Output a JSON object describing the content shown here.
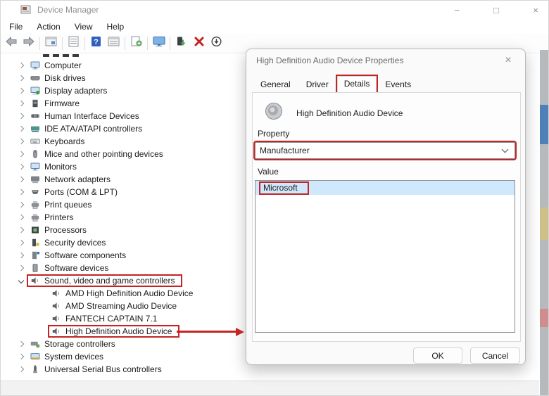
{
  "window": {
    "title": "Device Manager",
    "controls": {
      "minimize": "−",
      "maximize": "□",
      "close": "×"
    }
  },
  "menu": [
    "File",
    "Action",
    "View",
    "Help"
  ],
  "toolbar": [
    {
      "name": "nav-back-button",
      "icon": "back-icon"
    },
    {
      "name": "nav-forward-button",
      "icon": "forward-icon"
    },
    {
      "sep": true
    },
    {
      "name": "show-console-tree-button",
      "icon": "console-window-icon"
    },
    {
      "sep": true
    },
    {
      "name": "properties-button",
      "icon": "properties-icon"
    },
    {
      "sep": true
    },
    {
      "name": "help-button",
      "icon": "help-icon"
    },
    {
      "name": "items-list-button",
      "icon": "list-window-icon"
    },
    {
      "sep": true
    },
    {
      "name": "scan-hardware-button",
      "icon": "scan-hardware-icon"
    },
    {
      "sep": true
    },
    {
      "name": "computer-button",
      "icon": "monitor-icon"
    },
    {
      "sep": true
    },
    {
      "name": "update-driver-button",
      "icon": "update-driver-icon"
    },
    {
      "name": "uninstall-device-button",
      "icon": "uninstall-icon"
    },
    {
      "name": "disable-device-button",
      "icon": "disable-icon"
    }
  ],
  "tree": [
    {
      "label": "Computer",
      "level": 0,
      "chevron": "right",
      "icon": "monitor"
    },
    {
      "label": "Disk drives",
      "level": 0,
      "chevron": "right",
      "icon": "disk"
    },
    {
      "label": "Display adapters",
      "level": 0,
      "chevron": "right",
      "icon": "display"
    },
    {
      "label": "Firmware",
      "level": 0,
      "chevron": "right",
      "icon": "firmware"
    },
    {
      "label": "Human Interface Devices",
      "level": 0,
      "chevron": "right",
      "icon": "hid"
    },
    {
      "label": "IDE ATA/ATAPI controllers",
      "level": 0,
      "chevron": "right",
      "icon": "ide"
    },
    {
      "label": "Keyboards",
      "level": 0,
      "chevron": "right",
      "icon": "keyboard"
    },
    {
      "label": "Mice and other pointing devices",
      "level": 0,
      "chevron": "right",
      "icon": "mouse"
    },
    {
      "label": "Monitors",
      "level": 0,
      "chevron": "right",
      "icon": "monitor"
    },
    {
      "label": "Network adapters",
      "level": 0,
      "chevron": "right",
      "icon": "network"
    },
    {
      "label": "Ports (COM & LPT)",
      "level": 0,
      "chevron": "right",
      "icon": "ports"
    },
    {
      "label": "Print queues",
      "level": 0,
      "chevron": "right",
      "icon": "print"
    },
    {
      "label": "Printers",
      "level": 0,
      "chevron": "right",
      "icon": "print"
    },
    {
      "label": "Processors",
      "level": 0,
      "chevron": "right",
      "icon": "processor"
    },
    {
      "label": "Security devices",
      "level": 0,
      "chevron": "right",
      "icon": "security"
    },
    {
      "label": "Software components",
      "level": 0,
      "chevron": "right",
      "icon": "software"
    },
    {
      "label": "Software devices",
      "level": 0,
      "chevron": "right",
      "icon": "softdev"
    },
    {
      "label": "Sound, video and game controllers",
      "level": 0,
      "chevron": "down",
      "icon": "speaker",
      "boxed": true
    },
    {
      "label": "AMD High Definition Audio Device",
      "level": 1,
      "chevron": "none",
      "icon": "speaker"
    },
    {
      "label": "AMD Streaming Audio Device",
      "level": 1,
      "chevron": "none",
      "icon": "speaker"
    },
    {
      "label": "FANTECH CAPTAIN 7.1",
      "level": 1,
      "chevron": "none",
      "icon": "speaker"
    },
    {
      "label": "High Definition Audio Device",
      "level": 1,
      "chevron": "none",
      "icon": "speaker",
      "boxed": true,
      "arrow": true
    },
    {
      "label": "Storage controllers",
      "level": 0,
      "chevron": "right",
      "icon": "storage"
    },
    {
      "label": "System devices",
      "level": 0,
      "chevron": "right",
      "icon": "system"
    },
    {
      "label": "Universal Serial Bus controllers",
      "level": 0,
      "chevron": "right",
      "icon": "usb"
    }
  ],
  "dialog": {
    "title": "High Definition Audio Device Properties",
    "close": "×",
    "tabs": [
      {
        "label": "General"
      },
      {
        "label": "Driver"
      },
      {
        "label": "Details",
        "selected": true,
        "highlighted": true
      },
      {
        "label": "Events"
      }
    ],
    "device_name": "High Definition Audio Device",
    "property_label": "Property",
    "property_value": "Manufacturer",
    "value_label": "Value",
    "value_items": [
      {
        "label": "Microsoft",
        "selected": true,
        "highlighted": true
      }
    ],
    "ok_label": "OK",
    "cancel_label": "Cancel"
  },
  "colors": {
    "annotation_red": "#c42424",
    "selection_blue": "#cfe8fc",
    "help_blue": "#2f5ebe",
    "uninstall_red": "#c5221f"
  }
}
